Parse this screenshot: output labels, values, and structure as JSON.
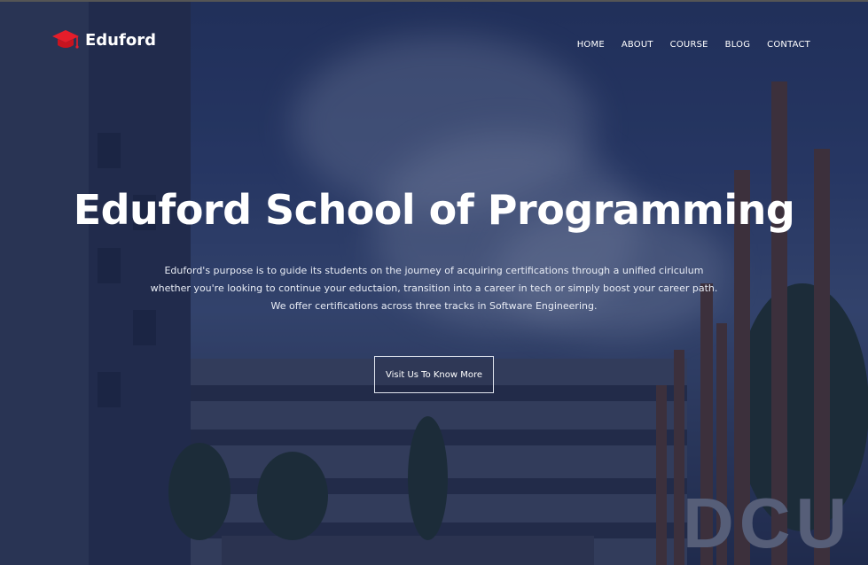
{
  "brand": {
    "name": "Eduford",
    "icon": "graduation-cap-icon",
    "accent": "#e51d2a"
  },
  "nav": {
    "items": [
      {
        "label": "HOME"
      },
      {
        "label": "ABOUT"
      },
      {
        "label": "COURSE"
      },
      {
        "label": "BLOG"
      },
      {
        "label": "CONTACT"
      }
    ]
  },
  "hero": {
    "title": "Eduford School of Programming",
    "description": [
      "Eduford's purpose is to guide its students on the journey of acquiring certifications through a unified ciriculum",
      "whether you're looking to continue your eductaion, transition into a career in tech or simply boost your career path.",
      "We offer certifications across three tracks in Software Engineering."
    ],
    "cta_label": "Visit Us To Know More",
    "background_sign": "DCU"
  }
}
